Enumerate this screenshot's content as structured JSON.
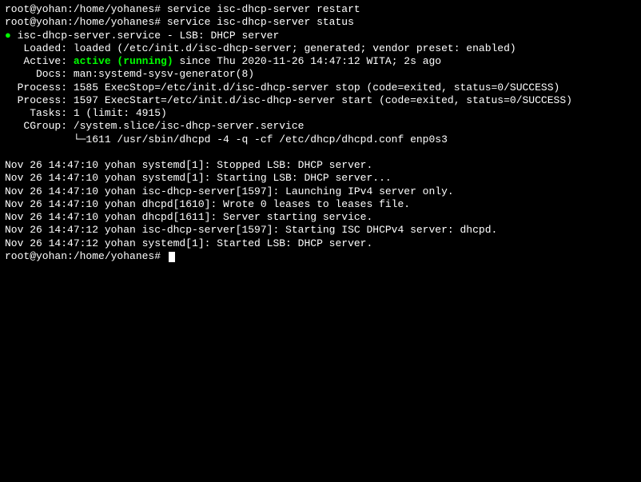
{
  "prompt": {
    "user_host": "root@yohan",
    "path": ":/home/yohanes# "
  },
  "commands": {
    "restart": "service isc-dhcp-server restart",
    "status": "service isc-dhcp-server status"
  },
  "status": {
    "bullet": "●",
    "service_line": " isc-dhcp-server.service - LSB: DHCP server",
    "loaded": "   Loaded: loaded (/etc/init.d/isc-dhcp-server; generated; vendor preset: enabled)",
    "active_label": "   Active: ",
    "active_value": "active (running)",
    "active_rest": " since Thu 2020-11-26 14:47:12 WITA; 2s ago",
    "docs": "     Docs: man:systemd-sysv-generator(8)",
    "process1": "  Process: 1585 ExecStop=/etc/init.d/isc-dhcp-server stop (code=exited, status=0/SUCCESS)",
    "process2": "  Process: 1597 ExecStart=/etc/init.d/isc-dhcp-server start (code=exited, status=0/SUCCESS)",
    "tasks": "    Tasks: 1 (limit: 4915)",
    "cgroup": "   CGroup: /system.slice/isc-dhcp-server.service",
    "cgroup2": "           └─1611 /usr/sbin/dhcpd -4 -q -cf /etc/dhcp/dhcpd.conf enp0s3"
  },
  "log": [
    "Nov 26 14:47:10 yohan systemd[1]: Stopped LSB: DHCP server.",
    "Nov 26 14:47:10 yohan systemd[1]: Starting LSB: DHCP server...",
    "Nov 26 14:47:10 yohan isc-dhcp-server[1597]: Launching IPv4 server only.",
    "Nov 26 14:47:10 yohan dhcpd[1610]: Wrote 0 leases to leases file.",
    "Nov 26 14:47:10 yohan dhcpd[1611]: Server starting service.",
    "Nov 26 14:47:12 yohan isc-dhcp-server[1597]: Starting ISC DHCPv4 server: dhcpd.",
    "Nov 26 14:47:12 yohan systemd[1]: Started LSB: DHCP server."
  ]
}
